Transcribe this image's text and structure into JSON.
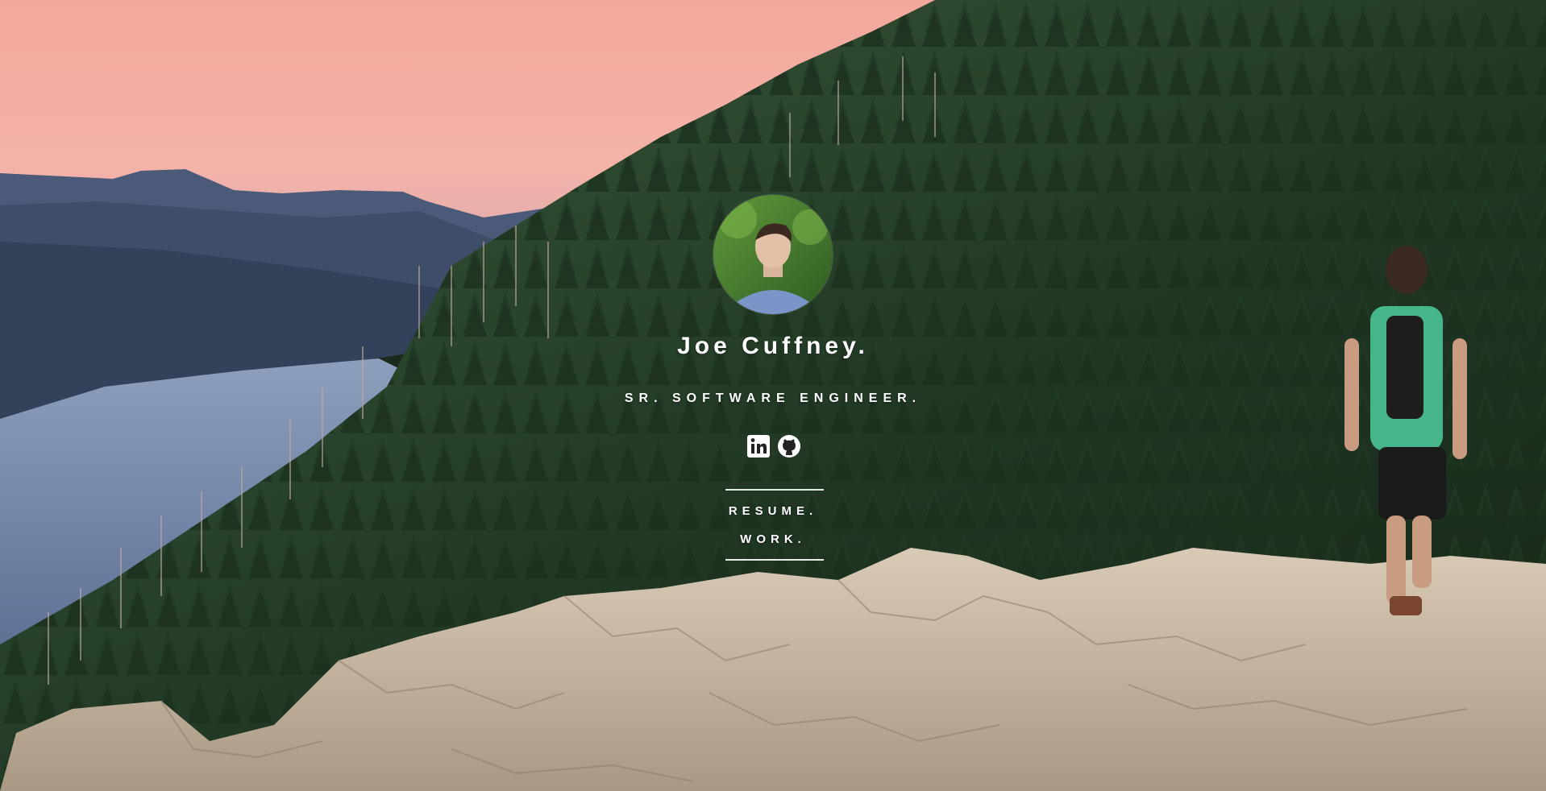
{
  "profile": {
    "name": "Joe Cuffney.",
    "title": "SR. SOFTWARE ENGINEER."
  },
  "social": [
    {
      "icon": "linkedin-icon",
      "label": "LinkedIn"
    },
    {
      "icon": "github-icon",
      "label": "GitHub"
    }
  ],
  "nav": {
    "resume": "RESUME.",
    "work": "WORK."
  },
  "colors": {
    "text": "#ffffff",
    "sky_top": "#f2a7a0",
    "forest": "#1f3522",
    "rock": "#c8b7a3"
  }
}
